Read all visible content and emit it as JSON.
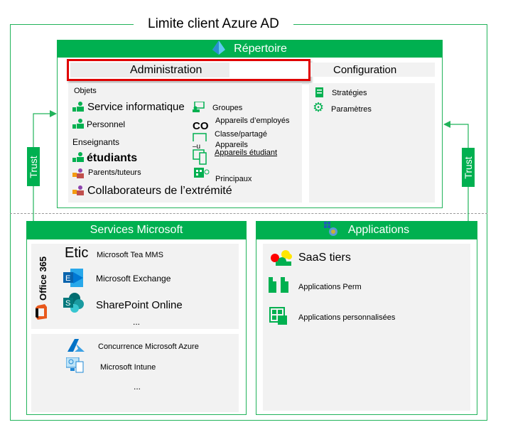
{
  "boundary": {
    "title": "Limite client Azure AD"
  },
  "directory": {
    "title": "Répertoire",
    "tabs": {
      "admin": "Administration",
      "config": "Configuration"
    },
    "objects": {
      "heading": "Objets",
      "items": [
        "Service informatique",
        "Personnel",
        "Enseignants",
        "étudiants",
        "Parents/tuteurs",
        "Collaborateurs de l’extrémité"
      ]
    },
    "groups": {
      "items": [
        "Groupes",
        "Appareils d’employés",
        "Classe/partagé",
        "Appareils",
        "Appareils étudiant",
        "Principaux"
      ],
      "co": "CO",
      "u": "–u"
    },
    "config": {
      "items": [
        "Stratégies",
        "Paramètres"
      ]
    }
  },
  "trust": {
    "left": "Trust",
    "right": "Trust"
  },
  "services": {
    "title": "Services Microsoft",
    "office_label": "Office 365",
    "office": {
      "teams_prefix": "Etic",
      "items": [
        "Microsoft Tea MMS",
        "Microsoft Exchange",
        "SharePoint Online"
      ],
      "more": "..."
    },
    "other": {
      "items": [
        "Concurrence Microsoft Azure",
        "Microsoft Intune"
      ],
      "more": "..."
    }
  },
  "applications": {
    "title": "Applications",
    "items": [
      "SaaS tiers",
      "Applications Perm",
      "Applications personnalisées"
    ]
  },
  "colors": {
    "green": "#00b050",
    "highlight": "#e00000",
    "panel": "#f2f2f2"
  }
}
